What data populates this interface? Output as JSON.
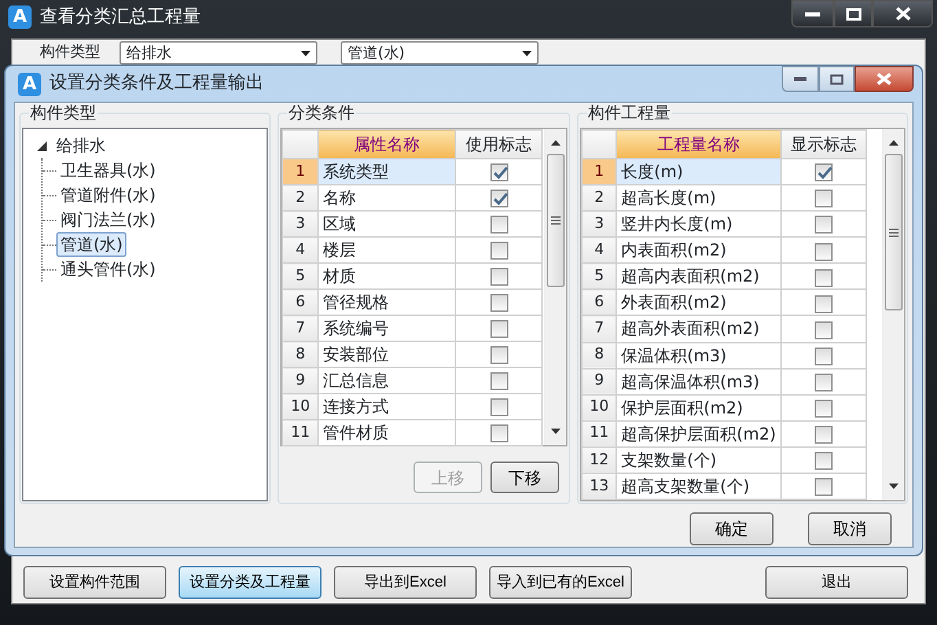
{
  "main_window": {
    "icon_text": "A",
    "title": "查看分类汇总工程量",
    "filter_label": "构件类型",
    "combos": [
      "给排水",
      "管道(水)"
    ],
    "buttons": [
      {
        "label": "设置构件范围",
        "selected": false
      },
      {
        "label": "设置分类及工程量",
        "selected": true
      },
      {
        "label": "导出到Excel",
        "selected": false
      },
      {
        "label": "导入到已有的Excel",
        "selected": false
      }
    ],
    "exit_button": "退出"
  },
  "dialog": {
    "icon_text": "A",
    "title": "设置分类条件及工程量输出",
    "component_types": {
      "title": "构件类型",
      "tree": [
        {
          "label": "给排水",
          "expanded": true,
          "selected": false,
          "children": [
            {
              "label": "卫生器具(水)",
              "selected": false
            },
            {
              "label": "管道附件(水)",
              "selected": false
            },
            {
              "label": "阀门法兰(水)",
              "selected": false
            },
            {
              "label": "管道(水)",
              "selected": true
            },
            {
              "label": "通头管件(水)",
              "selected": false
            }
          ]
        }
      ]
    },
    "classification": {
      "title": "分类条件",
      "columns": [
        "属性名称",
        "使用标志"
      ],
      "rows": [
        {
          "index": "1",
          "name": "系统类型",
          "checked": true,
          "selected": true
        },
        {
          "index": "2",
          "name": "名称",
          "checked": true,
          "selected": false
        },
        {
          "index": "3",
          "name": "区域",
          "checked": false,
          "selected": false
        },
        {
          "index": "4",
          "name": "楼层",
          "checked": false,
          "selected": false
        },
        {
          "index": "5",
          "name": "材质",
          "checked": false,
          "selected": false
        },
        {
          "index": "6",
          "name": "管径规格",
          "checked": false,
          "selected": false
        },
        {
          "index": "7",
          "name": "系统编号",
          "checked": false,
          "selected": false
        },
        {
          "index": "8",
          "name": "安装部位",
          "checked": false,
          "selected": false
        },
        {
          "index": "9",
          "name": "汇总信息",
          "checked": false,
          "selected": false
        },
        {
          "index": "10",
          "name": "连接方式",
          "checked": false,
          "selected": false
        },
        {
          "index": "11",
          "name": "管件材质",
          "checked": false,
          "selected": false
        }
      ],
      "buttons": [
        {
          "label": "上移",
          "disabled": true
        },
        {
          "label": "下移",
          "disabled": false
        }
      ]
    },
    "quantities": {
      "title": "构件工程量",
      "columns": [
        "工程量名称",
        "显示标志"
      ],
      "rows": [
        {
          "index": "1",
          "name": "长度(m)",
          "checked": true,
          "selected": true
        },
        {
          "index": "2",
          "name": "超高长度(m)",
          "checked": false,
          "selected": false
        },
        {
          "index": "3",
          "name": "竖井内长度(m)",
          "checked": false,
          "selected": false
        },
        {
          "index": "4",
          "name": "内表面积(m2)",
          "checked": false,
          "selected": false
        },
        {
          "index": "5",
          "name": "超高内表面积(m2)",
          "checked": false,
          "selected": false
        },
        {
          "index": "6",
          "name": "外表面积(m2)",
          "checked": false,
          "selected": false
        },
        {
          "index": "7",
          "name": "超高外表面积(m2)",
          "checked": false,
          "selected": false
        },
        {
          "index": "8",
          "name": "保温体积(m3)",
          "checked": false,
          "selected": false
        },
        {
          "index": "9",
          "name": "超高保温体积(m3)",
          "checked": false,
          "selected": false
        },
        {
          "index": "10",
          "name": "保护层面积(m2)",
          "checked": false,
          "selected": false
        },
        {
          "index": "11",
          "name": "超高保护层面积(m2)",
          "checked": false,
          "selected": false
        },
        {
          "index": "12",
          "name": "支架数量(个)",
          "checked": false,
          "selected": false
        },
        {
          "index": "13",
          "name": "超高支架数量(个)",
          "checked": false,
          "selected": false
        }
      ]
    },
    "footer_buttons": [
      "确定",
      "取消"
    ]
  }
}
